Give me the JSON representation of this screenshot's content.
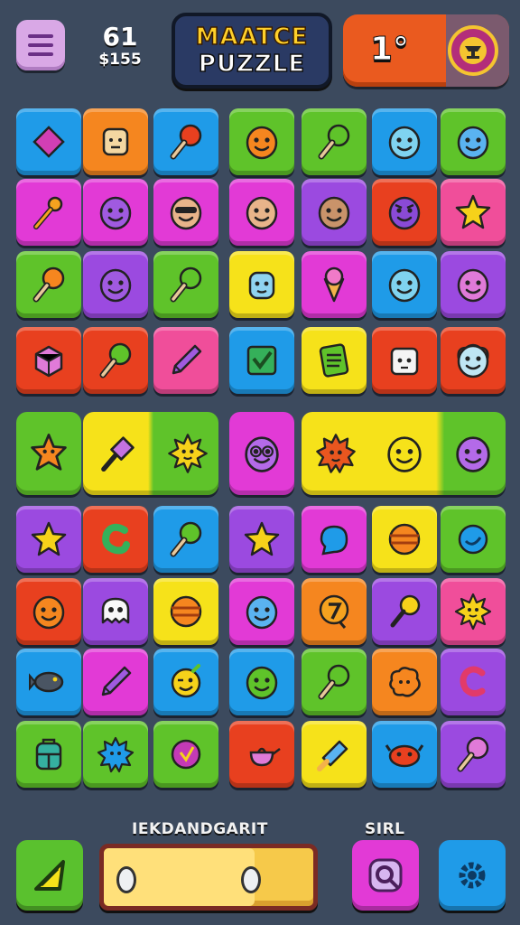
{
  "top_bar": {
    "score": "61",
    "score_sub": "$155",
    "title_line1": "MAATCE",
    "title_line2": "PUZZLE",
    "level": "1°"
  },
  "bottom_bar": {
    "progress_label": "IEKDANDGARIT",
    "progress_fraction": 0.72,
    "right_label": "SIRL"
  },
  "colors": {
    "blue": "#1f9be8",
    "orange": "#f5861f",
    "red": "#e8401f",
    "green": "#5fc32a",
    "magenta": "#e23ad6",
    "purple": "#9b4ae0",
    "pink": "#f04e9a",
    "yellow": "#f6e21a"
  },
  "tiles": [
    {
      "color": "blue",
      "icon": "pink-gem-icon"
    },
    {
      "color": "orange",
      "icon": "toast-icon"
    },
    {
      "color": "blue",
      "icon": "red-lollipop-icon"
    },
    {
      "color": "green",
      "icon": "orange-face-icon"
    },
    {
      "color": "green",
      "icon": "green-lollipop-icon"
    },
    {
      "color": "blue",
      "icon": "cyan-ghost-icon"
    },
    {
      "color": "green",
      "icon": "blue-egg-face-icon"
    },
    {
      "color": "magenta",
      "icon": "wand-icon"
    },
    {
      "color": "magenta",
      "icon": "purple-blob-face-icon"
    },
    {
      "color": "magenta",
      "icon": "masked-face-icon"
    },
    {
      "color": "magenta",
      "icon": "smiling-face-icon"
    },
    {
      "color": "purple",
      "icon": "brown-face-icon"
    },
    {
      "color": "red",
      "icon": "purple-angry-face-icon"
    },
    {
      "color": "pink",
      "icon": "star-icon"
    },
    {
      "color": "green",
      "icon": "orange-lollipop-icon"
    },
    {
      "color": "purple",
      "icon": "purple-blob-face-icon"
    },
    {
      "color": "green",
      "icon": "green-lollipop-icon"
    },
    {
      "color": "yellow",
      "icon": "robot-face-icon"
    },
    {
      "color": "magenta",
      "icon": "ice-cream-cone-icon"
    },
    {
      "color": "blue",
      "icon": "cyan-ghost-icon"
    },
    {
      "color": "purple",
      "icon": "pink-egg-face-icon"
    },
    {
      "color": "red",
      "icon": "pink-cube-icon"
    },
    {
      "color": "red",
      "icon": "green-lollipop-icon"
    },
    {
      "color": "pink",
      "icon": "pencil-icon"
    },
    {
      "color": "blue",
      "icon": "green-check-box-icon"
    },
    {
      "color": "yellow",
      "icon": "notebook-icon"
    },
    {
      "color": "red",
      "icon": "sugar-cube-face-icon"
    },
    {
      "color": "red",
      "icon": "fluffy-ghost-icon"
    },
    {
      "color": "purple",
      "icon": "star-icon"
    },
    {
      "color": "red",
      "icon": "green-swirl-icon"
    },
    {
      "color": "blue",
      "icon": "green-lollipop-icon"
    },
    {
      "color": "purple",
      "icon": "star-icon"
    },
    {
      "color": "magenta",
      "icon": "blue-bubble-icon"
    },
    {
      "color": "yellow",
      "icon": "beach-ball-icon"
    },
    {
      "color": "green",
      "icon": "blue-orb-icon"
    },
    {
      "color": "red",
      "icon": "orange-face-icon"
    },
    {
      "color": "purple",
      "icon": "skull-ghost-icon"
    },
    {
      "color": "yellow",
      "icon": "beach-ball-icon"
    },
    {
      "color": "magenta",
      "icon": "blue-egg-face-icon"
    },
    {
      "color": "orange",
      "icon": "number-badge-icon"
    },
    {
      "color": "purple",
      "icon": "racket-icon"
    },
    {
      "color": "pink",
      "icon": "sun-face-icon"
    },
    {
      "color": "blue",
      "icon": "dark-fish-icon"
    },
    {
      "color": "magenta",
      "icon": "pencil-icon"
    },
    {
      "color": "blue",
      "icon": "winking-face-icon"
    },
    {
      "color": "blue",
      "icon": "green-smiley-icon"
    },
    {
      "color": "green",
      "icon": "green-lollipop-icon"
    },
    {
      "color": "orange",
      "icon": "orange-splat-icon"
    },
    {
      "color": "purple",
      "icon": "magnet-swirl-icon"
    },
    {
      "color": "green",
      "icon": "backpack-icon"
    },
    {
      "color": "green",
      "icon": "blue-splat-icon"
    },
    {
      "color": "green",
      "icon": "purple-ball-icon"
    },
    {
      "color": "red",
      "icon": "teapot-icon"
    },
    {
      "color": "yellow",
      "icon": "brush-icon"
    },
    {
      "color": "blue",
      "icon": "red-crab-icon"
    },
    {
      "color": "purple",
      "icon": "pink-lollipop-icon"
    }
  ],
  "special_row": [
    {
      "color": "green",
      "icon": "orange-starfish-icon"
    },
    {
      "color": "yellow",
      "icon": "purple-candy-icon"
    },
    {
      "color": "green",
      "icon": "yellow-sun-face-icon"
    },
    {
      "color": "magenta",
      "icon": "glasses-face-icon"
    },
    {
      "color": "yellow",
      "icon": "orange-spiky-face-icon"
    },
    {
      "color": "yellow",
      "icon": "yellow-smiley-icon"
    },
    {
      "color": "green",
      "icon": "purple-egg-face-icon"
    }
  ]
}
